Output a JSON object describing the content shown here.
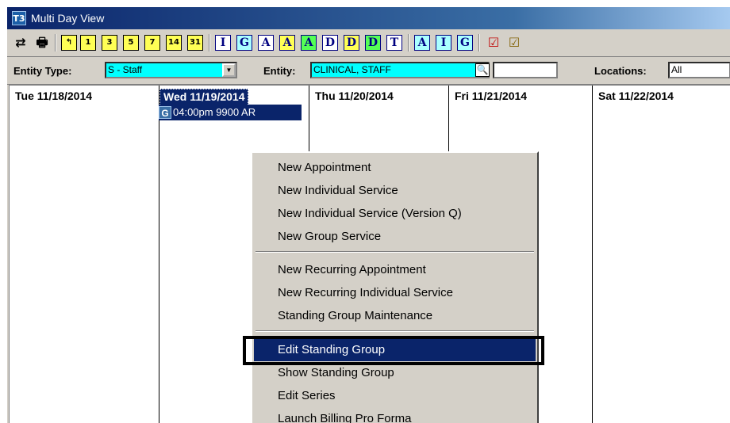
{
  "window": {
    "title": "Multi Day View",
    "icon_label": "T3"
  },
  "toolbar": {
    "refresh_glyph": "⇄",
    "print_glyph": "🖶",
    "calendar_buttons": [
      "↰",
      "1",
      "3",
      "5",
      "7",
      "14",
      "31"
    ],
    "group_a": [
      "I",
      "G",
      "A",
      "A",
      "A",
      "D",
      "D",
      "D",
      "T"
    ],
    "group_b": [
      "A",
      "I",
      "G"
    ],
    "check_glyph_1": "☑",
    "check_glyph_2": "☑"
  },
  "filters": {
    "entity_type_label": "Entity Type:",
    "entity_type_value": "S - Staff",
    "entity_label": "Entity:",
    "entity_value": "CLINICAL, STAFF",
    "search_glyph": "🔍",
    "locations_label": "Locations:",
    "locations_value": "All"
  },
  "days": [
    {
      "label": "Tue 11/18/2014",
      "selected": false
    },
    {
      "label": "Wed 11/19/2014",
      "selected": true
    },
    {
      "label": "Thu 11/20/2014",
      "selected": false
    },
    {
      "label": "Fri 11/21/2014",
      "selected": false
    },
    {
      "label": "Sat 11/22/2014",
      "selected": false
    }
  ],
  "appointment": {
    "badge": "G",
    "text": "04:00pm 9900 AR"
  },
  "context_menu": {
    "items": [
      "New Appointment",
      "New Individual Service",
      "New Individual Service (Version Q)",
      "New Group Service",
      "New Recurring Appointment",
      "New Recurring Individual Service",
      "Standing Group Maintenance",
      "Edit Standing Group",
      "Show Standing Group",
      "Edit Series",
      "Launch Billing Pro Forma"
    ],
    "highlighted": "Edit Standing Group"
  }
}
